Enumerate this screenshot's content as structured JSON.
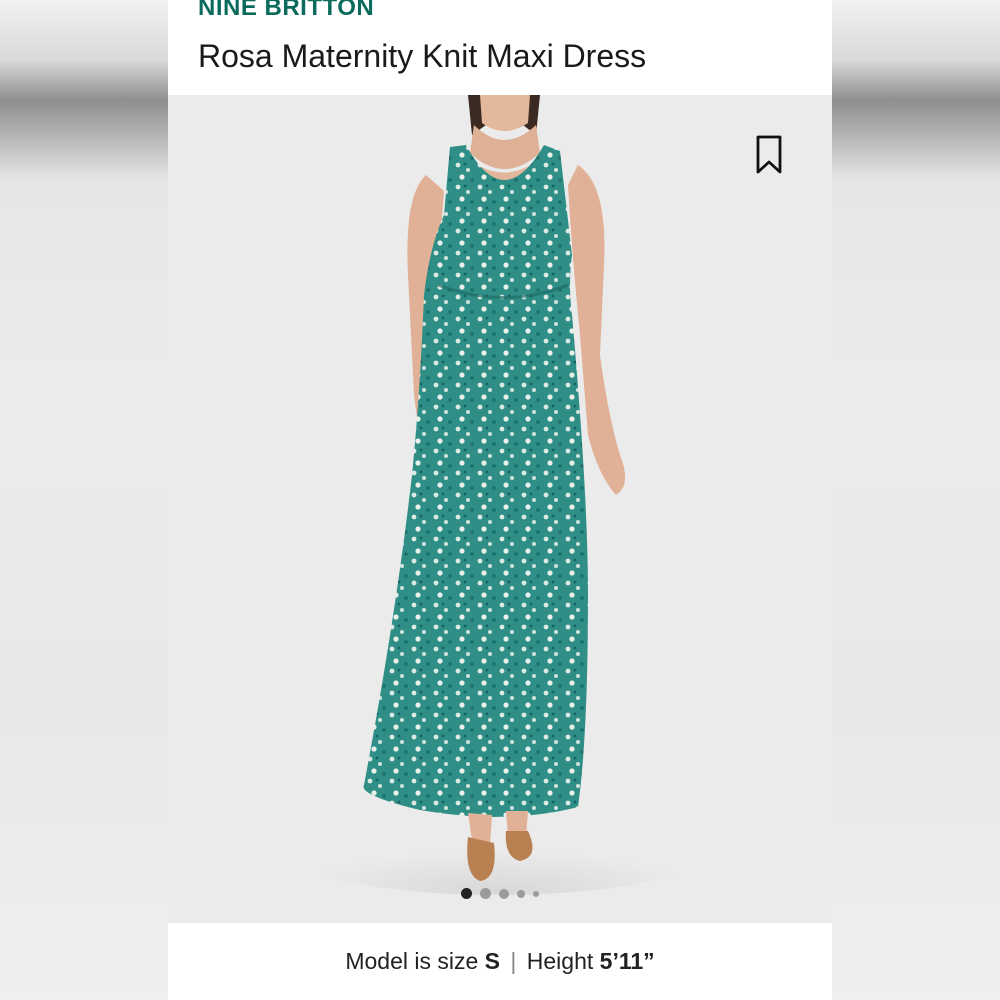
{
  "product": {
    "brand": "NINE BRITTON",
    "name": "Rosa Maternity Knit Maxi Dress"
  },
  "gallery": {
    "total_images": 5,
    "active_index": 0,
    "bookmark_icon": "bookmark-icon"
  },
  "caption": {
    "size_prefix": "Model is size",
    "size_value": "S",
    "separator": "|",
    "height_prefix": "Height",
    "height_value": "5’11”"
  },
  "colors": {
    "brand": "#0a6b5c",
    "dress": "#2f8f86",
    "dot_active": "#222222",
    "dot_inactive": "#9b9b9b"
  }
}
